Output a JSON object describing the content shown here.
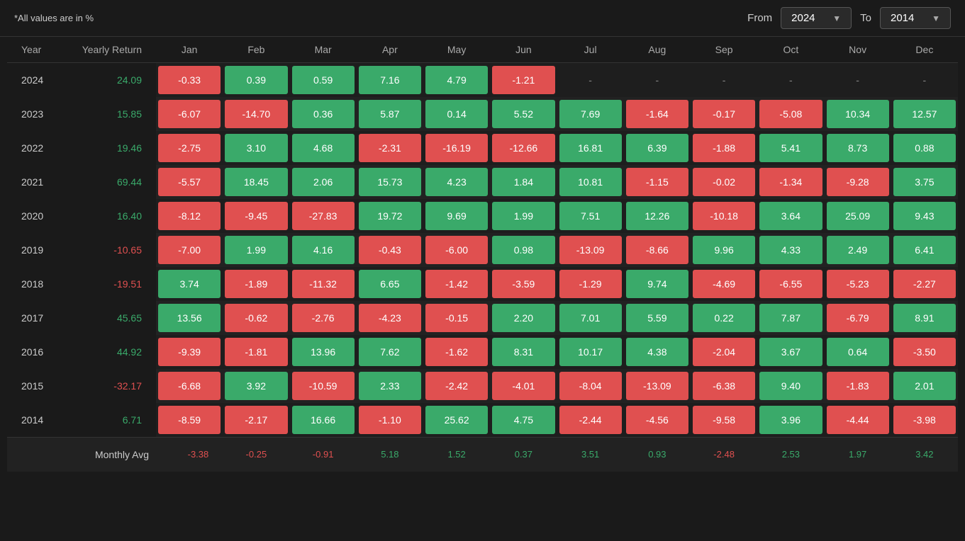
{
  "header": {
    "note": "*All values are in %",
    "from_label": "From",
    "to_label": "To",
    "from_value": "2024",
    "to_value": "2014"
  },
  "table": {
    "columns": {
      "year": "Year",
      "yearly_return": "Yearly Return",
      "months": [
        "Jan",
        "Feb",
        "Mar",
        "Apr",
        "May",
        "Jun",
        "Jul",
        "Aug",
        "Sep",
        "Oct",
        "Nov",
        "Dec"
      ]
    },
    "rows": [
      {
        "year": "2024",
        "yearly_return": "24.09",
        "yearly_positive": true,
        "months": [
          "-0.33",
          "0.39",
          "0.59",
          "7.16",
          "4.79",
          "-1.21",
          "-",
          "-",
          "-",
          "-",
          "-",
          "-"
        ]
      },
      {
        "year": "2023",
        "yearly_return": "15.85",
        "yearly_positive": true,
        "months": [
          "-6.07",
          "-14.70",
          "0.36",
          "5.87",
          "0.14",
          "5.52",
          "7.69",
          "-1.64",
          "-0.17",
          "-5.08",
          "10.34",
          "12.57"
        ]
      },
      {
        "year": "2022",
        "yearly_return": "19.46",
        "yearly_positive": true,
        "months": [
          "-2.75",
          "3.10",
          "4.68",
          "-2.31",
          "-16.19",
          "-12.66",
          "16.81",
          "6.39",
          "-1.88",
          "5.41",
          "8.73",
          "0.88"
        ]
      },
      {
        "year": "2021",
        "yearly_return": "69.44",
        "yearly_positive": true,
        "months": [
          "-5.57",
          "18.45",
          "2.06",
          "15.73",
          "4.23",
          "1.84",
          "10.81",
          "-1.15",
          "-0.02",
          "-1.34",
          "-9.28",
          "3.75"
        ]
      },
      {
        "year": "2020",
        "yearly_return": "16.40",
        "yearly_positive": true,
        "months": [
          "-8.12",
          "-9.45",
          "-27.83",
          "19.72",
          "9.69",
          "1.99",
          "7.51",
          "12.26",
          "-10.18",
          "3.64",
          "25.09",
          "9.43"
        ]
      },
      {
        "year": "2019",
        "yearly_return": "-10.65",
        "yearly_positive": false,
        "months": [
          "-7.00",
          "1.99",
          "4.16",
          "-0.43",
          "-6.00",
          "0.98",
          "-13.09",
          "-8.66",
          "9.96",
          "4.33",
          "2.49",
          "6.41"
        ]
      },
      {
        "year": "2018",
        "yearly_return": "-19.51",
        "yearly_positive": false,
        "months": [
          "3.74",
          "-1.89",
          "-11.32",
          "6.65",
          "-1.42",
          "-3.59",
          "-1.29",
          "9.74",
          "-4.69",
          "-6.55",
          "-5.23",
          "-2.27"
        ]
      },
      {
        "year": "2017",
        "yearly_return": "45.65",
        "yearly_positive": true,
        "months": [
          "13.56",
          "-0.62",
          "-2.76",
          "-4.23",
          "-0.15",
          "2.20",
          "7.01",
          "5.59",
          "0.22",
          "7.87",
          "-6.79",
          "8.91"
        ]
      },
      {
        "year": "2016",
        "yearly_return": "44.92",
        "yearly_positive": true,
        "months": [
          "-9.39",
          "-1.81",
          "13.96",
          "7.62",
          "-1.62",
          "8.31",
          "10.17",
          "4.38",
          "-2.04",
          "3.67",
          "0.64",
          "-3.50"
        ]
      },
      {
        "year": "2015",
        "yearly_return": "-32.17",
        "yearly_positive": false,
        "months": [
          "-6.68",
          "3.92",
          "-10.59",
          "2.33",
          "-2.42",
          "-4.01",
          "-8.04",
          "-13.09",
          "-6.38",
          "9.40",
          "-1.83",
          "2.01"
        ]
      },
      {
        "year": "2014",
        "yearly_return": "6.71",
        "yearly_positive": true,
        "months": [
          "-8.59",
          "-2.17",
          "16.66",
          "-1.10",
          "25.62",
          "4.75",
          "-2.44",
          "-4.56",
          "-9.58",
          "3.96",
          "-4.44",
          "-3.98"
        ]
      }
    ],
    "monthly_avg": {
      "label": "Monthly Avg",
      "values": [
        "-3.38",
        "-0.25",
        "-0.91",
        "5.18",
        "1.52",
        "0.37",
        "3.51",
        "0.93",
        "-2.48",
        "2.53",
        "1.97",
        "3.42"
      ]
    }
  }
}
